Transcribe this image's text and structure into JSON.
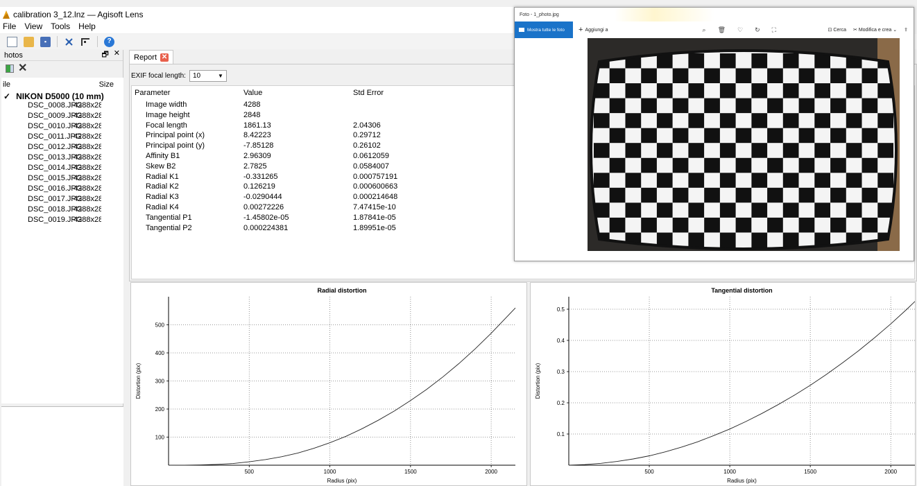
{
  "app": {
    "title": "calibration 3_12.lnz — Agisoft Lens",
    "menu": [
      "File",
      "View",
      "Tools",
      "Help"
    ],
    "toolbar_icons": [
      "new-file-icon",
      "open-folder-icon",
      "save-icon",
      "calibrate-icon",
      "chessboard-icon",
      "help-icon"
    ]
  },
  "photos_pane": {
    "title": "hotos",
    "float_glyph": "🗗",
    "close_glyph": "✕",
    "delete_glyph": "✕",
    "col_file": "ile",
    "col_size": "Size",
    "group_arrow": "✓",
    "group": "NIKON D5000 (10 mm)",
    "files": [
      {
        "name": "DSC_0008.JPG",
        "size": "4288x28"
      },
      {
        "name": "DSC_0009.JPG",
        "size": "4288x28"
      },
      {
        "name": "DSC_0010.JPG",
        "size": "4288x28"
      },
      {
        "name": "DSC_0011.JPG",
        "size": "4288x28"
      },
      {
        "name": "DSC_0012.JPG",
        "size": "4288x28"
      },
      {
        "name": "DSC_0013.JPG",
        "size": "4288x28"
      },
      {
        "name": "DSC_0014.JPG",
        "size": "4288x28"
      },
      {
        "name": "DSC_0015.JPG",
        "size": "4288x28"
      },
      {
        "name": "DSC_0016.JPG",
        "size": "4288x28"
      },
      {
        "name": "DSC_0017.JPG",
        "size": "4288x28"
      },
      {
        "name": "DSC_0018.JPG",
        "size": "4288x28"
      },
      {
        "name": "DSC_0019.JPG",
        "size": "4288x28"
      }
    ],
    "scroll_left": "<",
    "scroll_right": ">"
  },
  "report": {
    "tab_label": "Report",
    "tab_close": "✕",
    "exif_label": "EXIF focal length:",
    "exif_value": "10",
    "exif_arrow": "▼",
    "headers": {
      "parameter": "Parameter",
      "value": "Value",
      "std_error": "Std Error"
    },
    "rows": [
      {
        "param": "Image width",
        "value": "4288",
        "err": ""
      },
      {
        "param": "Image height",
        "value": "2848",
        "err": ""
      },
      {
        "param": "Focal length",
        "value": "1861.13",
        "err": "2.04306"
      },
      {
        "param": "Principal point (x)",
        "value": "8.42223",
        "err": "0.29712"
      },
      {
        "param": "Principal point (y)",
        "value": "-7.85128",
        "err": "0.26102"
      },
      {
        "param": "Affinity B1",
        "value": "2.96309",
        "err": "0.0612059"
      },
      {
        "param": "Skew B2",
        "value": "2.7825",
        "err": "0.0584007"
      },
      {
        "param": "Radial K1",
        "value": "-0.331265",
        "err": "0.000757191"
      },
      {
        "param": "Radial K2",
        "value": "0.126219",
        "err": "0.000600663"
      },
      {
        "param": "Radial K3",
        "value": "-0.0290444",
        "err": "0.000214648"
      },
      {
        "param": "Radial K4",
        "value": "0.00272226",
        "err": "7.47415e-10"
      },
      {
        "param": "Tangential P1",
        "value": "-1.45802e-05",
        "err": "1.87841e-05"
      },
      {
        "param": "Tangential P2",
        "value": "0.000224381",
        "err": "1.89951e-05"
      }
    ]
  },
  "photos_app": {
    "title": "Foto - 1_photo.jpg",
    "show_all": "Mostra tutte le foto",
    "add": "Aggiungi a",
    "add_glyph": "+",
    "toolbar_glyphs": [
      "⌕",
      "🗑",
      "♡",
      "↻",
      "⛶"
    ],
    "search": "Cerca",
    "search_glyph": "⊡",
    "edit": "Modifica e crea",
    "edit_glyph": "✂",
    "chevron_glyph": "⌄",
    "share_glyph": "⇪",
    "image_subject": "checkerboard"
  },
  "chart_data": [
    {
      "type": "line",
      "title": "Radial distortion",
      "xlabel": "Radius (pix)",
      "ylabel": "Distortion (pix)",
      "xlim": [
        0,
        2150
      ],
      "ylim": [
        0,
        600
      ],
      "xticks": [
        500,
        1000,
        1500,
        2000
      ],
      "yticks": [
        100,
        200,
        300,
        400,
        500
      ],
      "grid": true,
      "x": [
        0,
        100,
        200,
        300,
        400,
        500,
        600,
        700,
        800,
        900,
        1000,
        1100,
        1200,
        1300,
        1400,
        1500,
        1600,
        1700,
        1800,
        1900,
        2000,
        2100,
        2150
      ],
      "y": [
        0,
        0.2,
        1,
        3,
        6,
        12,
        20,
        30,
        43,
        60,
        80,
        103,
        130,
        160,
        193,
        230,
        270,
        314,
        362,
        414,
        470,
        530,
        560
      ]
    },
    {
      "type": "line",
      "title": "Tangential distortion",
      "xlabel": "Radius (pix)",
      "ylabel": "Distortion (pix)",
      "xlim": [
        0,
        2150
      ],
      "ylim": [
        0,
        0.54
      ],
      "xticks": [
        500,
        1000,
        1500,
        2000
      ],
      "yticks": [
        0.1,
        0.2,
        0.3,
        0.4,
        0.5
      ],
      "ytick_labels": [
        "0.1",
        "0.2",
        "0.3",
        "0.4",
        "0.5"
      ],
      "grid": true,
      "x": [
        0,
        100,
        200,
        300,
        400,
        500,
        600,
        700,
        800,
        900,
        1000,
        1100,
        1200,
        1300,
        1400,
        1500,
        1600,
        1700,
        1800,
        1900,
        2000,
        2100,
        2150
      ],
      "y": [
        0,
        0.002,
        0.006,
        0.012,
        0.02,
        0.03,
        0.043,
        0.058,
        0.075,
        0.095,
        0.116,
        0.14,
        0.166,
        0.194,
        0.224,
        0.256,
        0.291,
        0.328,
        0.367,
        0.409,
        0.453,
        0.5,
        0.525
      ]
    }
  ]
}
